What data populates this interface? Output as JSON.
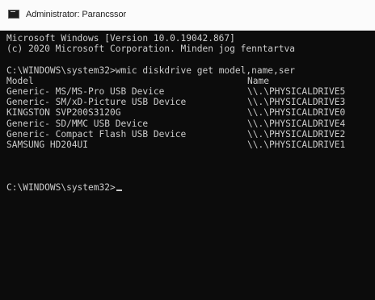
{
  "window": {
    "title": "Administrator: Parancssor",
    "icon": "cmd-console-icon"
  },
  "console": {
    "banner_line1": "Microsoft Windows [Version 10.0.19042.867]",
    "banner_line2": "(c) 2020 Microsoft Corporation. Minden jog fenntartva",
    "command_prompt": "C:\\WINDOWS\\system32>",
    "command_text": "wmic diskdrive get model,name,ser",
    "headers": {
      "model": "Model",
      "name": "Name"
    },
    "rows": [
      {
        "model": "Generic- MS/MS-Pro USB Device",
        "name": "\\\\.\\PHYSICALDRIVE5"
      },
      {
        "model": "Generic- SM/xD-Picture USB Device",
        "name": "\\\\.\\PHYSICALDRIVE3"
      },
      {
        "model": "KINGSTON SVP200S3120G",
        "name": "\\\\.\\PHYSICALDRIVE0"
      },
      {
        "model": "Generic- SD/MMC USB Device",
        "name": "\\\\.\\PHYSICALDRIVE4"
      },
      {
        "model": "Generic- Compact Flash USB Device",
        "name": "\\\\.\\PHYSICALDRIVE2"
      },
      {
        "model": "SAMSUNG HD204UI",
        "name": "\\\\.\\PHYSICALDRIVE1"
      }
    ],
    "final_prompt": "C:\\WINDOWS\\system32>"
  },
  "colors": {
    "console_background": "#0c0c0c",
    "console_text": "#cccccc",
    "titlebar_background": "#fbfbfb"
  }
}
